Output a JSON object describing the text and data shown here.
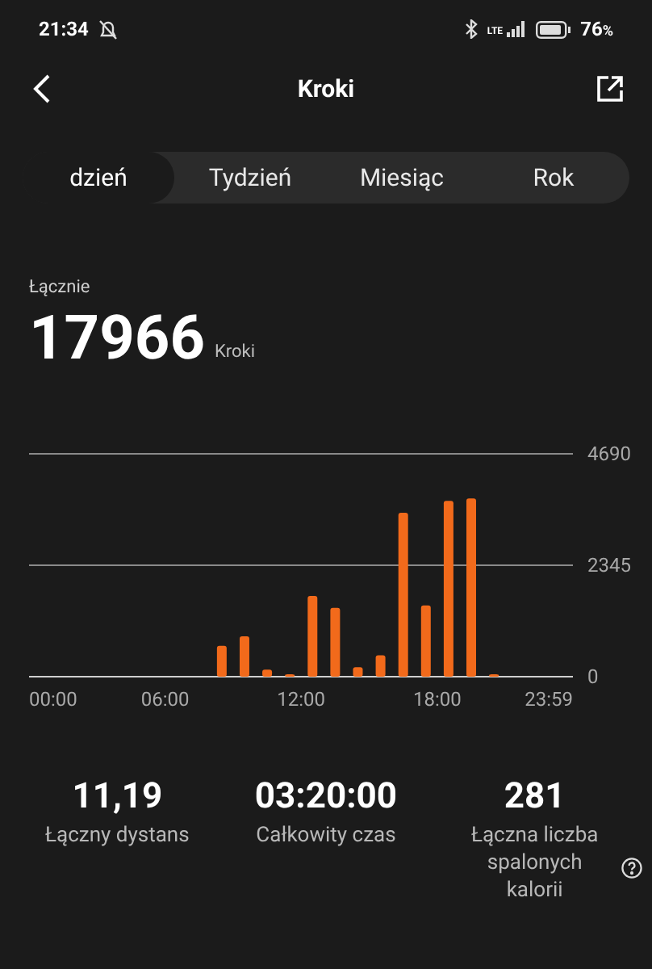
{
  "status_bar": {
    "time": "21:34",
    "network": "LTE",
    "battery": "76",
    "battery_unit": "%"
  },
  "header": {
    "title": "Kroki"
  },
  "tabs": [
    {
      "label": "dzień",
      "selected": true
    },
    {
      "label": "Tydzień",
      "selected": false
    },
    {
      "label": "Miesiąc",
      "selected": false
    },
    {
      "label": "Rok",
      "selected": false
    }
  ],
  "total": {
    "label": "Łącznie",
    "value": "17966",
    "unit": "Kroki"
  },
  "chart_data": {
    "type": "bar",
    "x": [
      510,
      570,
      630,
      690,
      750,
      810,
      870,
      930,
      990,
      1050,
      1110,
      1170,
      1230
    ],
    "series": [
      {
        "color": "#f26a1b",
        "values": [
          650,
          850,
          150,
          50,
          1700,
          1450,
          200,
          450,
          3450,
          1500,
          3700,
          3750,
          50
        ]
      }
    ],
    "xlim": [
      0,
      1439
    ],
    "ylim": [
      0,
      4690
    ],
    "yticks": [
      0,
      2345,
      4690
    ],
    "xticks": [
      {
        "value": 0,
        "label": "00:00"
      },
      {
        "value": 360,
        "label": "06:00"
      },
      {
        "value": 720,
        "label": "12:00"
      },
      {
        "value": 1080,
        "label": "18:00"
      },
      {
        "value": 1439,
        "label": "23:59"
      }
    ]
  },
  "stats": [
    {
      "value": "11,19",
      "label": "Łączny dystans",
      "help": false
    },
    {
      "value": "03:20:00",
      "label": "Całkowity czas",
      "help": false
    },
    {
      "value": "281",
      "label": "Łączna liczba spalonych kalorii",
      "help": true
    }
  ]
}
